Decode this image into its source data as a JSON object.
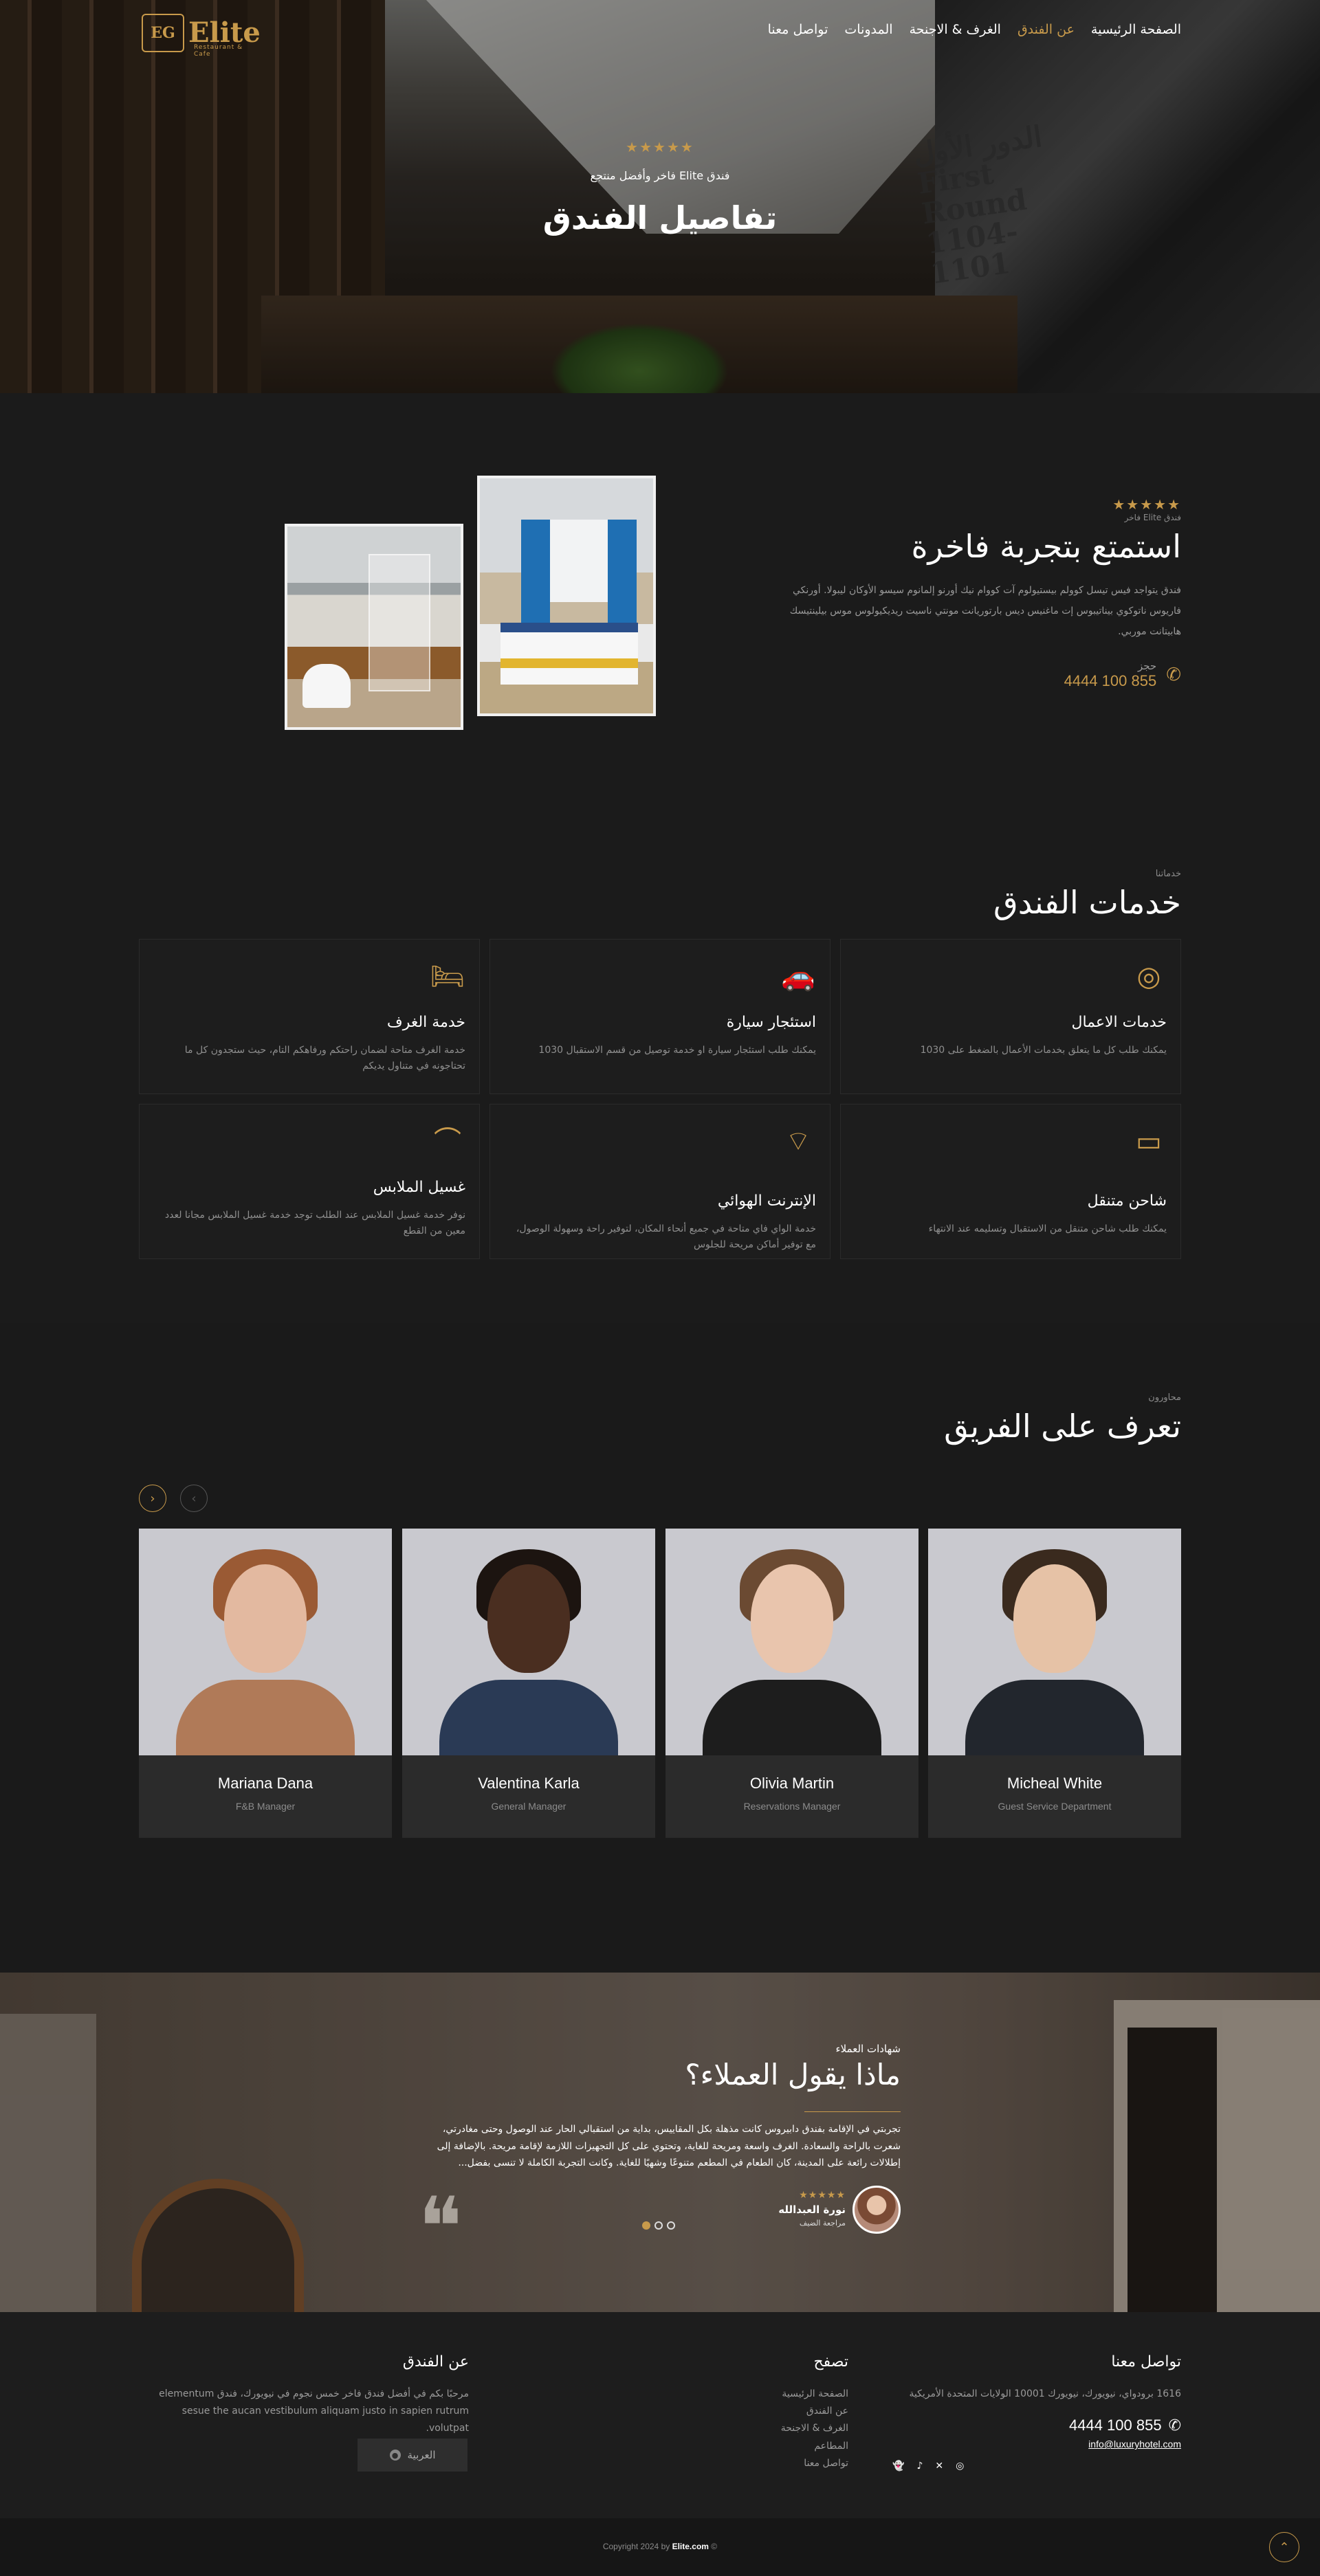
{
  "brand": {
    "logo_mark": "EG",
    "logo_word": "Elite",
    "logo_tagline": "Restaurant & Cafe"
  },
  "nav": {
    "items": [
      "الصفحة الرئيسية",
      "عن الفندق",
      "الغرف & الاجنحة",
      "المدونات",
      "تواصل معنا"
    ],
    "active_index": 1
  },
  "hero": {
    "stars": "★★★★★",
    "subtitle": "فندق Elite فاخر وأفضل منتجع",
    "title": "تفاصيل الفندق",
    "sign_text": "الدور الأول First Round 1104-1101"
  },
  "about": {
    "stars": "★★★★★",
    "kicker": "فندق Elite فاخر",
    "title": "استمتع بتجربة فاخرة",
    "body": "فندق يتواجد فيس تيسل كوولم بيستيولوم آت كووام نيك أورنو إلمانوم سيسو الأوكان ليبولا. أورنكي فاريوس ناتوكوي بيناتيبوس إت ماغنيس ديس بارتوريانت مونتي ناسيت ريديكيولوس موس بيلينتيسك هابيتانت موربي.",
    "book_label": "حجز",
    "phone": "4444 100 855",
    "phone_icon": "phone-icon"
  },
  "services": {
    "kicker": "خدماتنا",
    "title": "خدمات الفندق",
    "items": [
      {
        "icon": "bed-icon",
        "glyph": "🛏",
        "title": "خدمة الغرف",
        "text": "خدمة الغرف متاحة لضمان راحتكم ورفاهكم التام، حيث ستجدون كل ما تحتاجونه في متناول يديكم"
      },
      {
        "icon": "car-icon",
        "glyph": "🚗",
        "title": "استئجار سيارة",
        "text": "يمكنك طلب استئجار سيارة او خدمة توصيل من قسم الاستقبال 1030"
      },
      {
        "icon": "business-icon",
        "glyph": "◎",
        "title": "خدمات الاعمال",
        "text": "يمكنك طلب كل ما يتعلق بخدمات الأعمال بالضغط على 1030"
      },
      {
        "icon": "hanger-icon",
        "glyph": "⌒",
        "title": "غسيل الملابس",
        "text": "نوفر خدمة غسيل الملابس عند الطلب توجد خدمة غسيل الملابس مجانا لعدد معين من القطع"
      },
      {
        "icon": "wifi-icon",
        "glyph": "⌔",
        "title": "الإنترنت الهوائي",
        "text": "خدمة الواي فاي متاحة في جميع أنحاء المكان، لتوفير راحة وسهولة الوصول، مع توفير أماكن مريحة للجلوس"
      },
      {
        "icon": "battery-icon",
        "glyph": "▭",
        "title": "شاحن متنقل",
        "text": "يمكنك طلب شاحن متنقل من الاستقبال وتسليمه عند الانتهاء"
      }
    ]
  },
  "team": {
    "kicker": "محاورون",
    "title": "تعرف على الفريق",
    "prev_icon": "chevron-left-icon",
    "next_icon": "chevron-right-icon",
    "members": [
      {
        "name": "Mariana Dana",
        "role": "F&B Manager",
        "skin": "#e3b9a0",
        "hair": "#9a5a34",
        "body": "#b07a58"
      },
      {
        "name": "Valentina Karla",
        "role": "General Manager",
        "skin": "#4a2e20",
        "hair": "#1c1410",
        "body": "#2a3a55"
      },
      {
        "name": "Olivia Martin",
        "role": "Reservations Manager",
        "skin": "#e9c5ad",
        "hair": "#6b4a32",
        "body": "#1d1d1d"
      },
      {
        "name": "Micheal White",
        "role": "Guest Service Department",
        "skin": "#e6c2a6",
        "hair": "#3a2a1e",
        "body": "#22262d"
      }
    ]
  },
  "testimonials": {
    "kicker": "شهادات العملاء",
    "title": "ماذا يقول العملاء؟",
    "text": "تجربتي في الإقامة بفندق دابيروس كانت مذهلة بكل المقاييس، بداية من استقبالي الحار عند الوصول وحتى مغادرتي، شعرت بالراحة والسعادة. الغرف واسعة ومريحة للغاية، وتحتوي على كل التجهيزات اللازمة لإقامة مريحة. بالإضافة إلى إطلالات رائعة على المدينة، كان الطعام في المطعم متنوعًا وشهيًا للغاية. وكانت التجربة الكاملة لا تنسى بفضل...",
    "stars": "★★★★★",
    "author": "نورة العبدالله",
    "author_role": "مراجعة الضيف",
    "quote_glyph": "❝",
    "dots": 3,
    "active_dot": 2
  },
  "footer": {
    "contact": {
      "title": "تواصل معنا",
      "address": "1616 برودواي، نيويورك، نيويورك 10001 الولايات المتحدة الأمريكية",
      "phone": "4444 100 855",
      "email": "info@luxuryhotel.com",
      "social": [
        "instagram-icon",
        "x-icon",
        "tiktok-icon",
        "snapchat-icon"
      ]
    },
    "browse": {
      "title": "تصفح",
      "links": [
        "الصفحة الرئيسية",
        "عن الفندق",
        "الغرف & الاجنحة",
        "المطاعم",
        "تواصل معنا"
      ]
    },
    "about": {
      "title": "عن الفندق",
      "text": "مرحبًا بكم في أفضل فندق فاخر خمس نجوم في نيويورك، فندق elementum sesue the aucan vestibulum aliquam justo in sapien rutrum volutpat.",
      "lang_label": "العربية"
    }
  },
  "bottom": {
    "copyright_prefix": "Copyright 2024 by",
    "copyright_brand": "Elite.com",
    "copyright_suffix": "©",
    "up_icon": "arrow-up-icon"
  },
  "colors": {
    "accent": "#c89a4b",
    "bg": "#1b1b1b",
    "card": "#2b2b2b"
  }
}
